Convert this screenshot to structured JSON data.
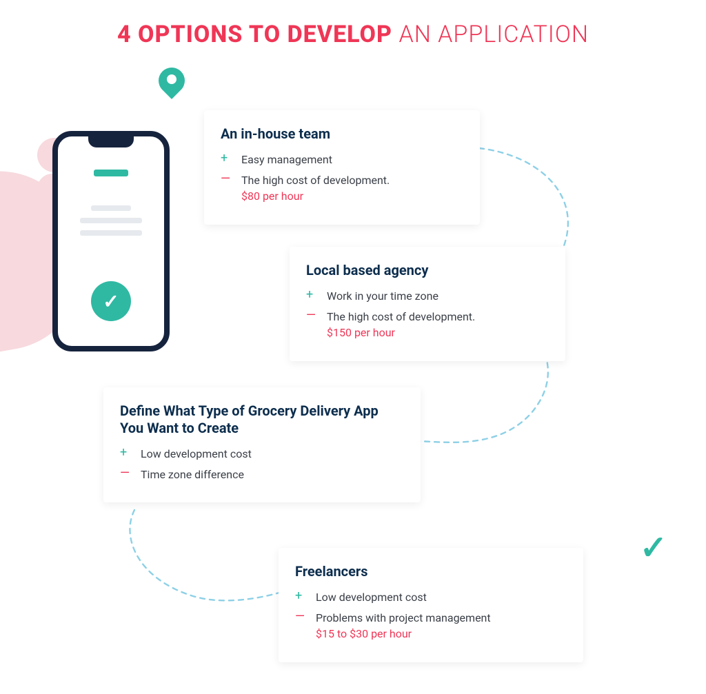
{
  "title": {
    "bold": "4 OPTIONS TO DEVELOP",
    "thin": "AN APPLICATION"
  },
  "cards": {
    "inhouse": {
      "heading": "An in-house team",
      "pro": "Easy management",
      "con": "The high cost of development.",
      "price": "$80 per hour"
    },
    "local": {
      "heading": "Local based agency",
      "pro": "Work in your time zone",
      "con": "The high cost of development.",
      "price": "$150 per hour"
    },
    "define": {
      "heading": "Define What Type of Grocery Delivery App You Want to Create",
      "pro": "Low development cost",
      "con": "Time zone difference"
    },
    "freelancers": {
      "heading": "Freelancers",
      "pro": "Low development cost",
      "con": "Problems with project management",
      "price": "$15 to $30 per hour"
    }
  }
}
